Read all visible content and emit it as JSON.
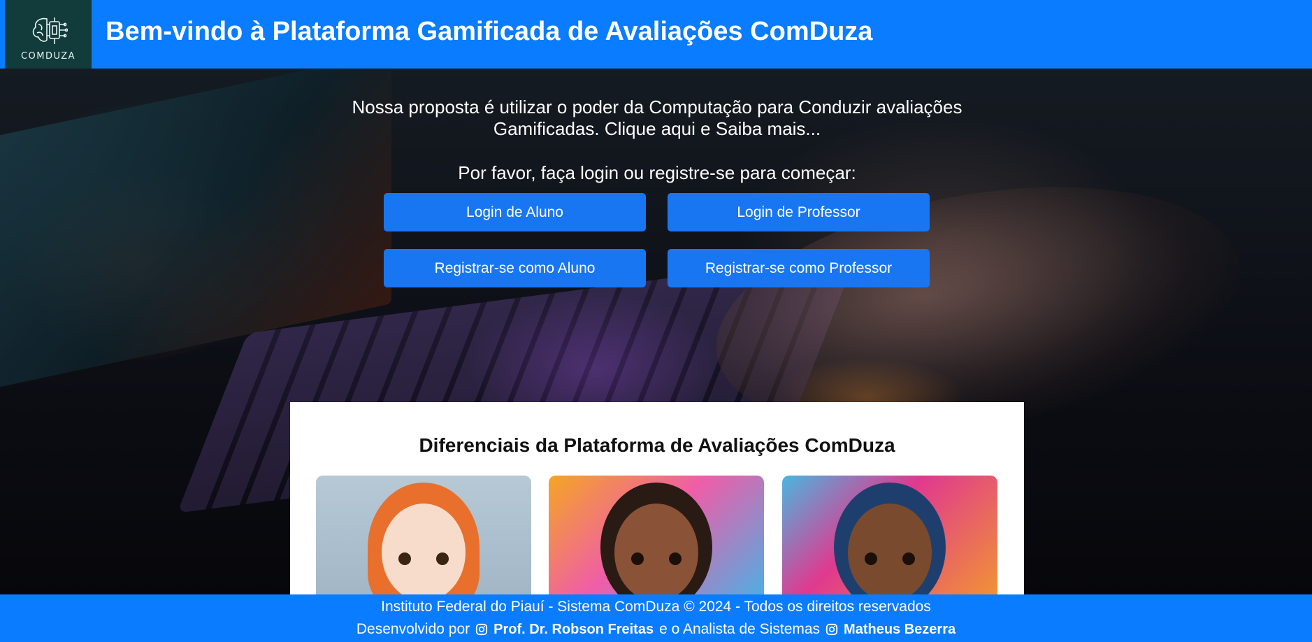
{
  "header": {
    "logo_text": "COMDUZA",
    "title": "Bem-vindo à Plataforma Gamificada de Avaliações ComDuza"
  },
  "hero": {
    "intro": "Nossa proposta é utilizar o poder da Computação para Conduzir avaliações Gamificadas. Clique aqui e Saiba mais...",
    "prompt": "Por favor, faça login ou registre-se para começar:",
    "buttons": {
      "login_aluno": "Login de Aluno",
      "login_professor": "Login de Professor",
      "register_aluno": "Registrar-se como Aluno",
      "register_professor": "Registrar-se como Professor"
    }
  },
  "features": {
    "title": "Diferenciais da Plataforma de Avaliações ComDuza"
  },
  "footer": {
    "line1": "Instituto Federal do Piauí - Sistema ComDuza © 2024 - Todos os direitos reservados",
    "developed_by": "Desenvolvido por",
    "author1": "Prof. Dr. Robson Freitas",
    "connector": "e o Analista de Sistemas",
    "author2": "Matheus Bezerra"
  },
  "colors": {
    "primary": "#0a7cff",
    "button": "#1976f2",
    "logo_bg": "#123c3c"
  },
  "icons": [
    "instagram-icon",
    "brain-chip-icon"
  ]
}
